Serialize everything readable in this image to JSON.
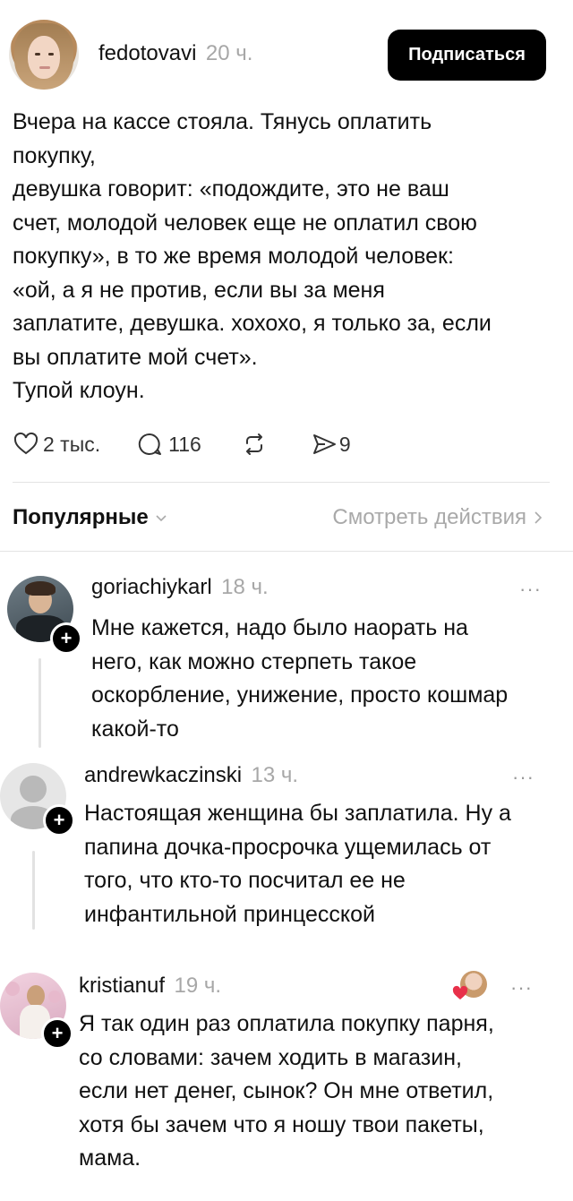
{
  "post": {
    "username": "fedotovavi",
    "time": "20 ч.",
    "follow_label": "Подписаться",
    "text": "Вчера на кассе стояла. Тянусь оплатить\nпокупку,\nдевушка говорит: «подождите, это не ваш\nсчет, молодой человек еще не оплатил свою\nпокупку», в то же время молодой человек:\n«ой, а я не против, если вы за меня\nзаплатите, девушка. хохохо, я только за, если\nвы оплатите мой счет».\nТупой клоун.",
    "likes": "2 тыс.",
    "comments": "116",
    "shares": "9",
    "icons": [
      "heart-icon",
      "comment-icon",
      "repost-icon",
      "send-icon"
    ]
  },
  "sort": {
    "label": "Популярные",
    "see_actions": "Смотреть действия"
  },
  "comments": [
    {
      "username": "goriachiykarl",
      "time": "18 ч.",
      "text": "Мне кажется, надо было наорать на\nнего, как можно стерпеть такое\nоскорбление, унижение, просто кошмар\nкакой-то"
    },
    {
      "username": "andrewkaczinski",
      "time": "13 ч.",
      "text": "Настоящая женщина бы заплатила. Ну а\nпапина дочка-просрочка ущемилась от\nтого, что кто-то посчитал ее не\nинфантильной принцесской"
    },
    {
      "username": "kristianuf",
      "time": "19 ч.",
      "text": "Я так один раз оплатила покупку парня,\nсо словами: зачем ходить в магазин,\nесли нет денег, сынок? Он мне ответил,\nхотя бы зачем что я ношу твои пакеты,\nмама."
    }
  ],
  "more_label": "···",
  "plus_label": "+",
  "colors": {
    "accent": "#000000",
    "muted": "#a7a7a7",
    "like_red": "#e8304a"
  }
}
